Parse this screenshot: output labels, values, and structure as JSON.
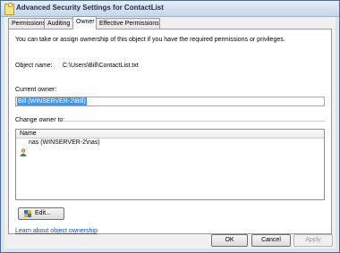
{
  "window": {
    "title": "Advanced Security Settings for ContactList"
  },
  "tabs": [
    {
      "label": "Permissions",
      "active": false
    },
    {
      "label": "Auditing",
      "active": false
    },
    {
      "label": "Owner",
      "active": true
    },
    {
      "label": "Effective Permissions",
      "active": false
    }
  ],
  "owner_tab": {
    "intro": "You can take or assign ownership of this object if you have the required permissions or privileges.",
    "object_name_label": "Object name:",
    "object_name_value": "C:\\Users\\Bill\\ContactList.txt",
    "current_owner_label": "Current owner:",
    "current_owner_value": "Bill (WINSERVER-2\\Bill)",
    "change_owner_label": "Change owner to:",
    "list_header": "Name",
    "list_items": [
      {
        "icon": "user-icon",
        "name": "nas (WINSERVER-2\\nas)"
      }
    ],
    "edit_button": "Edit...",
    "learn_link": "Learn about object ownership"
  },
  "footer": {
    "ok": "OK",
    "cancel": "Cancel",
    "apply": "Apply"
  },
  "colors": {
    "selection": "#3399ff",
    "link": "#0a4fb8",
    "title_text": "#1c2f48"
  }
}
